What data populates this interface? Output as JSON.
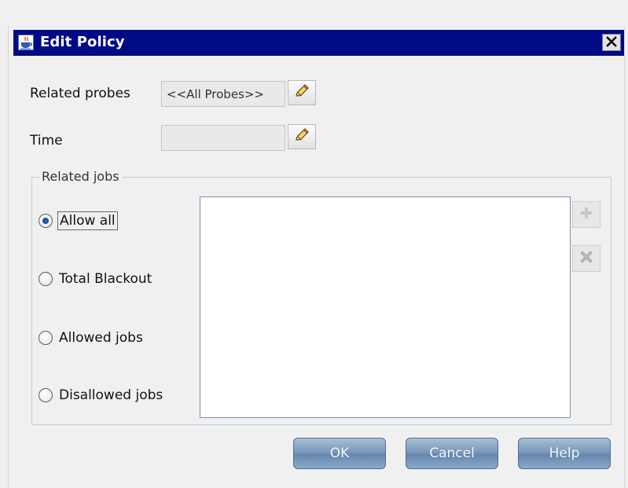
{
  "window": {
    "title": "Edit Policy",
    "close_symbol": "✕"
  },
  "fields": {
    "related_probes_label": "Related probes",
    "related_probes_value": "<<All Probes>>",
    "time_label": "Time",
    "time_value": ""
  },
  "related_jobs": {
    "group_label": "Related jobs",
    "options": [
      {
        "label": "Allow all",
        "selected": true
      },
      {
        "label": "Total Blackout",
        "selected": false
      },
      {
        "label": "Allowed jobs",
        "selected": false
      },
      {
        "label": "Disallowed jobs",
        "selected": false
      }
    ],
    "side_buttons": {
      "add_icon": "plus-icon",
      "remove_icon": "delete-icon"
    }
  },
  "buttons": {
    "ok_label": "OK",
    "cancel_label": "Cancel",
    "help_label": "Help"
  },
  "icons": {
    "app": "java-cup-icon",
    "edit": "pencil-icon",
    "close": "close-icon"
  },
  "colors": {
    "titlebar": "#000a85",
    "button_gradient_top": "#a7bed6",
    "button_gradient_bottom": "#6688b0",
    "group_border": "#b8cfe5"
  }
}
